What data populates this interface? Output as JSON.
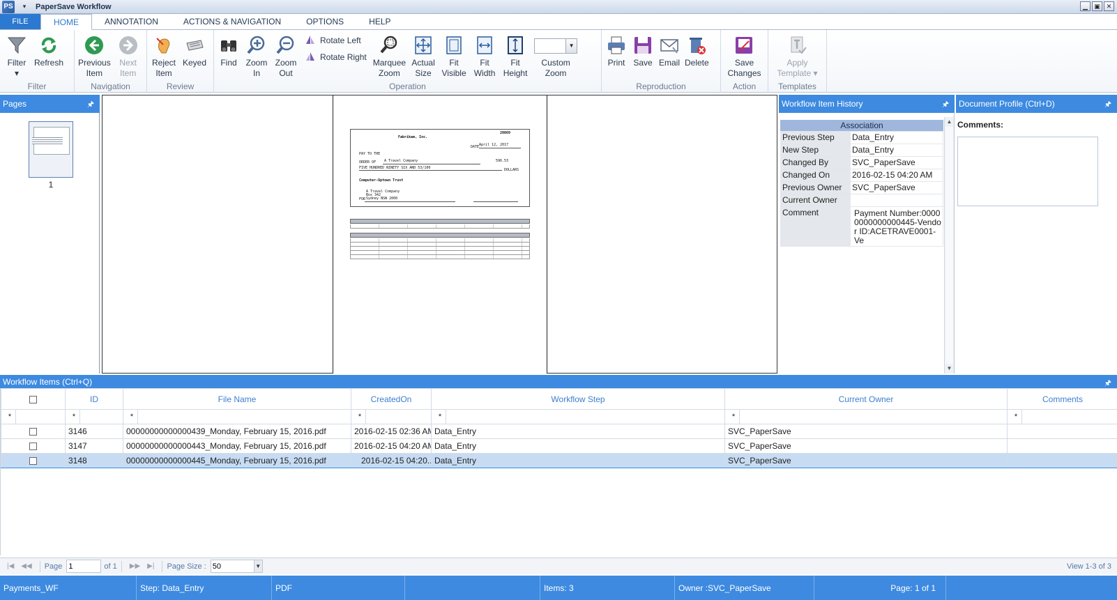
{
  "app": {
    "title": "PaperSave Workflow",
    "icon": "papersave-logo-icon",
    "icon_text": "PS"
  },
  "window_buttons": {
    "minimize": "▁",
    "maximize": "▣",
    "close": "✕"
  },
  "tabs": {
    "file": "FILE",
    "items": [
      "HOME",
      "ANNOTATION",
      "ACTIONS & NAVIGATION",
      "OPTIONS",
      "HELP"
    ],
    "active": "HOME"
  },
  "ribbon": {
    "filter": {
      "label": "Filter",
      "group": "Filter"
    },
    "refresh": {
      "label": "Refresh"
    },
    "navigation": {
      "previous_1": "Previous",
      "previous_2": "Item",
      "next_1": "Next",
      "next_2": "Item",
      "group": "Navigation"
    },
    "review": {
      "reject_1": "Reject",
      "reject_2": "Item",
      "keyed": "Keyed",
      "group": "Review"
    },
    "operation": {
      "find": "Find",
      "zoom_in_1": "Zoom",
      "zoom_in_2": "In",
      "zoom_out_1": "Zoom",
      "zoom_out_2": "Out",
      "rotate_left": "Rotate Left",
      "rotate_right": "Rotate Right",
      "marquee_1": "Marquee",
      "marquee_2": "Zoom",
      "actual_1": "Actual",
      "actual_2": "Size",
      "fit_visible_1": "Fit",
      "fit_visible_2": "Visible",
      "fit_width_1": "Fit",
      "fit_width_2": "Width",
      "fit_height_1": "Fit",
      "fit_height_2": "Height",
      "custom_1": "Custom",
      "custom_2": "Zoom",
      "custom_zoom_value": "",
      "group": "Operation"
    },
    "reproduction": {
      "print": "Print",
      "save": "Save",
      "email": "Email",
      "delete": "Delete",
      "group": "Reproduction"
    },
    "action": {
      "save_changes_1": "Save",
      "save_changes_2": "Changes",
      "group": "Action"
    },
    "templates": {
      "apply_1": "Apply",
      "apply_2": "Template ▾",
      "group": "Templates"
    }
  },
  "pages_panel": {
    "title": "Pages",
    "page_number": "1"
  },
  "document": {
    "company": "Fabrikam, Inc.",
    "check_number": "20069",
    "date_label": "DATE",
    "date": "April 12, 2017",
    "pay_to": "PAY TO THE",
    "order_of": "ORDER OF",
    "payee": "A Travel Company",
    "amount": "596.53",
    "amount_words": "FIVE HUNDRED NINETY SIX  AND 53/100",
    "dollars": "DOLLARS",
    "bank": "Computer-Uptown Trust",
    "address_1": "A Travel Company",
    "address_2": "Box 342",
    "address_3": "Sydney NSW 2000",
    "for_label": "FOR"
  },
  "history_panel": {
    "title": "Workflow Item History",
    "section": "Association",
    "rows": [
      {
        "key": "Previous Step",
        "value": "Data_Entry"
      },
      {
        "key": "New Step",
        "value": "Data_Entry"
      },
      {
        "key": "Changed By",
        "value": "SVC_PaperSave"
      },
      {
        "key": "Changed On",
        "value": "2016-02-15 04:20 AM"
      },
      {
        "key": "Previous Owner",
        "value": "SVC_PaperSave"
      },
      {
        "key": "Current Owner",
        "value": ""
      }
    ],
    "comment_key": "Comment",
    "comment_value": "Payment Number:00000000000000445-Vendor ID:ACETRAVE0001-Ve"
  },
  "profile_panel": {
    "title": "Document Profile (Ctrl+D)",
    "comments_label": "Comments:"
  },
  "grid": {
    "title": "Workflow Items (Ctrl+Q)",
    "columns": [
      "ID",
      "File Name",
      "CreatedOn",
      "Workflow Step",
      "Current Owner",
      "Comments"
    ],
    "filter_symbol": "*",
    "rows": [
      {
        "id": "3146",
        "file": "00000000000000439_Monday, February 15, 2016.pdf",
        "created": "2016-02-15 02:36 AM",
        "step": "Data_Entry",
        "owner": "SVC_PaperSave",
        "comments": ""
      },
      {
        "id": "3147",
        "file": "00000000000000443_Monday, February 15, 2016.pdf",
        "created": "2016-02-15 04:20 AM",
        "step": "Data_Entry",
        "owner": "SVC_PaperSave",
        "comments": ""
      },
      {
        "id": "3148",
        "file": "00000000000000445_Monday,  February  15,  2016.pdf",
        "created": "2016-02-15 04:20...",
        "step": "Data_Entry",
        "owner": "SVC_PaperSave",
        "comments": ""
      }
    ],
    "selected_row": 2
  },
  "pager": {
    "page_label": "Page",
    "page_value": "1",
    "of_label": "of 1",
    "page_size_label": "Page Size :",
    "page_size_value": "50",
    "view_info": "View 1-3 of 3"
  },
  "status_bar": {
    "workflow": "Payments_WF",
    "step": "Step: Data_Entry",
    "type": "PDF",
    "blank": "",
    "items": "Items: 3",
    "owner": "Owner :SVC_PaperSave",
    "page": "Page: 1 of 1"
  },
  "colors": {
    "accent": "#3d8ae0",
    "file_tab": "#2b79d0",
    "selected_row": "#c7dcf3"
  }
}
